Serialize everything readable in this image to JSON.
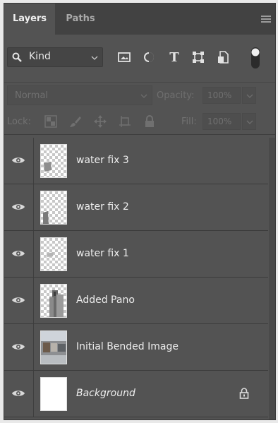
{
  "tabs": [
    {
      "label": "Layers",
      "active": true
    },
    {
      "label": "Paths",
      "active": false
    }
  ],
  "filter": {
    "kind_label": "Kind",
    "icons": [
      "image-filter-icon",
      "adjustment-filter-icon",
      "type-filter-icon",
      "shape-filter-icon",
      "smart-object-filter-icon"
    ]
  },
  "blend": {
    "mode": "Normal",
    "opacity_label": "Opacity:",
    "opacity_value": "100%"
  },
  "lock": {
    "label": "Lock:",
    "fill_label": "Fill:",
    "fill_value": "100%"
  },
  "layers": [
    {
      "name": "water fix 3",
      "visible": true
    },
    {
      "name": "water fix 2",
      "visible": true
    },
    {
      "name": "water fix 1",
      "visible": true
    },
    {
      "name": "Added Pano",
      "visible": true
    },
    {
      "name": "Initial Bended Image",
      "visible": true
    },
    {
      "name": "Background",
      "visible": true,
      "locked": true,
      "italic": true
    }
  ],
  "colors": {
    "panel_bg": "#535353",
    "tab_bar_bg": "#424242",
    "text": "#eeeeee",
    "disabled_text": "#717171"
  }
}
